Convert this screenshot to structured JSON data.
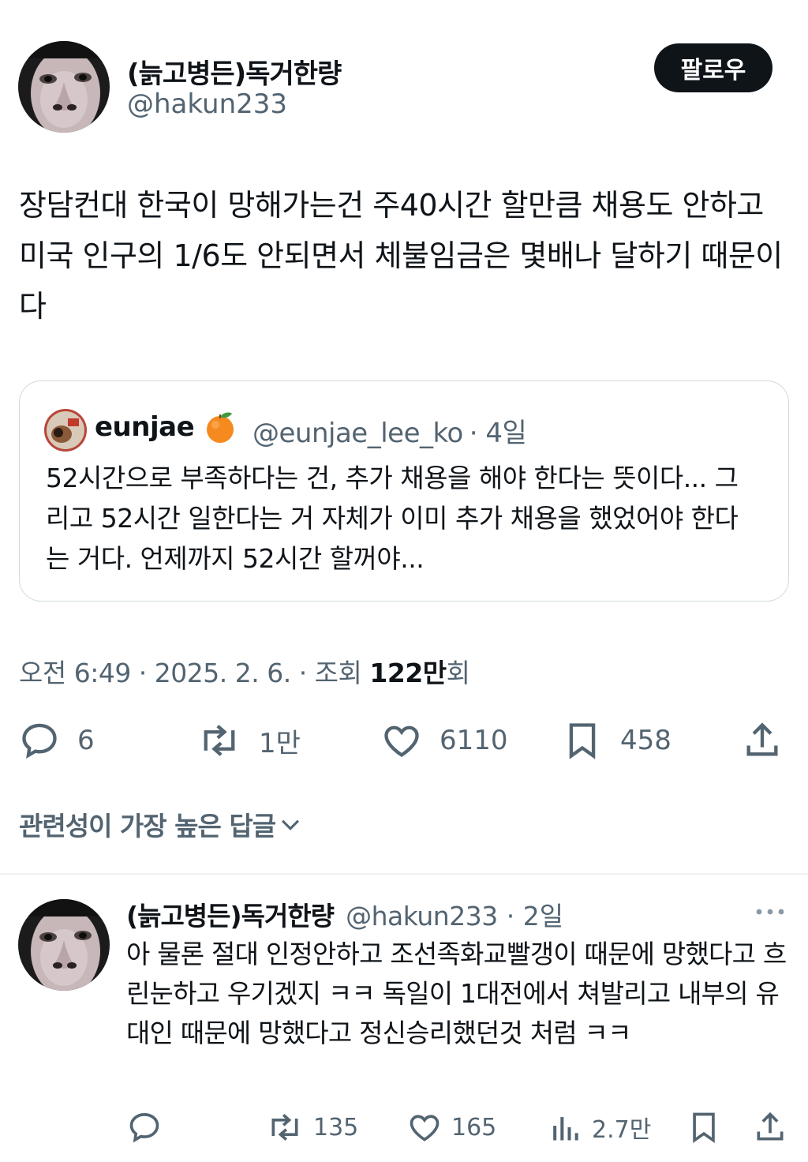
{
  "tweet": {
    "author_name": "(늙고병든)독거한량",
    "author_handle": "@hakun233",
    "follow_label": "팔로우",
    "text": "장담컨대 한국이 망해가는건 주40시간 할만큼 채용도 안하고 미국 인구의 1/6도 안되면서 체불임금은 몇배나 달하기 때문이다",
    "quote": {
      "name": "eunjae",
      "emoji": "🍊",
      "handle": "@eunjae_lee_ko",
      "time": "· 4일",
      "text": "52시간으로 부족하다는 건, 추가 채용을 해야 한다는 뜻이다... 그리고 52시간 일한다는 거 자체가 이미 추가 채용을 했었어야 한다는 거다. 언제까지 52시간 할꺼야..."
    },
    "meta": {
      "time_date": "오전 6:49 · 2025. 2. 6. · 조회 ",
      "views": "122만",
      "views_suffix": "회"
    },
    "actions": {
      "replies": "6",
      "retweets": "1만",
      "likes": "6110",
      "bookmarks": "458"
    }
  },
  "replies_sort_label": "관련성이 가장 높은 답글",
  "reply": {
    "author_name": "(늙고병든)독거한량",
    "author_handle": "@hakun233",
    "time": "· 2일",
    "text": "아 물론 절대 인정안하고 조선족화교빨갱이 때문에 망했다고 흐린눈하고 우기겠지 ㅋㅋ 독일이 1대전에서 쳐발리고 내부의 유대인 때문에 망했다고 정신승리했던것 처럼 ㅋㅋ",
    "actions": {
      "retweets": "135",
      "likes": "165",
      "views": "2.7만"
    }
  },
  "colors": {
    "text": "#0f1419",
    "secondary": "#536471",
    "border": "#cfd9de",
    "divider": "#eff3f4"
  }
}
